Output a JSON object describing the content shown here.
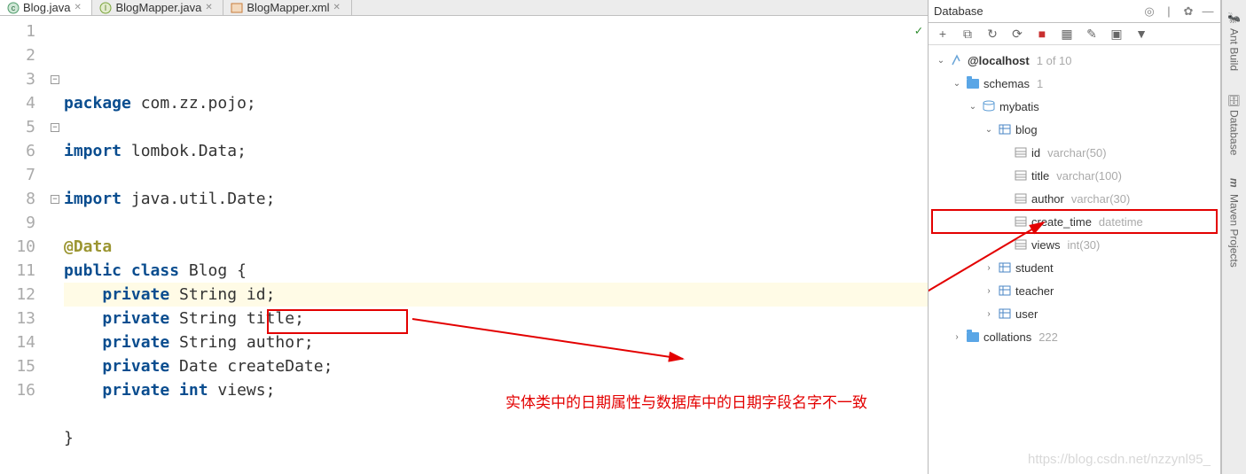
{
  "tabs": [
    {
      "icon": "c",
      "iconColor": "#1f8a4c",
      "label": "Blog.java",
      "active": true
    },
    {
      "icon": "I",
      "iconColor": "#7aa53b",
      "label": "BlogMapper.java",
      "active": false
    },
    {
      "icon": "x",
      "iconColor": "#c77d3a",
      "label": "BlogMapper.xml",
      "active": false
    }
  ],
  "editor": {
    "lines": [
      {
        "n": 1,
        "html": "<span class='kw'>package</span> com.zz.pojo;"
      },
      {
        "n": 2,
        "html": ""
      },
      {
        "n": 3,
        "html": "<span class='kw'>import</span> lombok.Data;",
        "fold": true
      },
      {
        "n": 4,
        "html": ""
      },
      {
        "n": 5,
        "html": "<span class='kw'>import</span> java.util.Date;",
        "fold": true
      },
      {
        "n": 6,
        "html": ""
      },
      {
        "n": 7,
        "html": "<span class='ann'>@Data</span>"
      },
      {
        "n": 8,
        "html": "<span class='kw'>public class</span> Blog {",
        "fold": true
      },
      {
        "n": 9,
        "html": "    <span class='kw'>private</span> String id;",
        "hl": true
      },
      {
        "n": 10,
        "html": "    <span class='kw'>private</span> String title;"
      },
      {
        "n": 11,
        "html": "    <span class='kw'>private</span> String author;"
      },
      {
        "n": 12,
        "html": "    <span class='kw'>private</span> Date createDate;"
      },
      {
        "n": 13,
        "html": "    <span class='kw'>private int</span> views;"
      },
      {
        "n": 14,
        "html": ""
      },
      {
        "n": 15,
        "html": "}"
      },
      {
        "n": 16,
        "html": ""
      }
    ]
  },
  "database": {
    "title": "Database",
    "root": "@localhost",
    "rootHint": "1 of 10",
    "schemas": {
      "label": "schemas",
      "count": "1"
    },
    "schemaName": "mybatis",
    "tables": [
      {
        "name": "blog",
        "expanded": true,
        "columns": [
          {
            "name": "id",
            "type": "varchar(50)"
          },
          {
            "name": "title",
            "type": "varchar(100)"
          },
          {
            "name": "author",
            "type": "varchar(30)"
          },
          {
            "name": "create_time",
            "type": "datetime",
            "highlight": true
          },
          {
            "name": "views",
            "type": "int(30)"
          }
        ]
      },
      {
        "name": "student"
      },
      {
        "name": "teacher"
      },
      {
        "name": "user"
      }
    ],
    "collations": {
      "label": "collations",
      "count": "222"
    }
  },
  "annotation": "实体类中的日期属性与数据库中的日期字段名字不一致",
  "rightTabs": [
    "Ant Build",
    "Database",
    "Maven Projects"
  ],
  "watermark": "https://blog.csdn.net/nzzynl95_"
}
